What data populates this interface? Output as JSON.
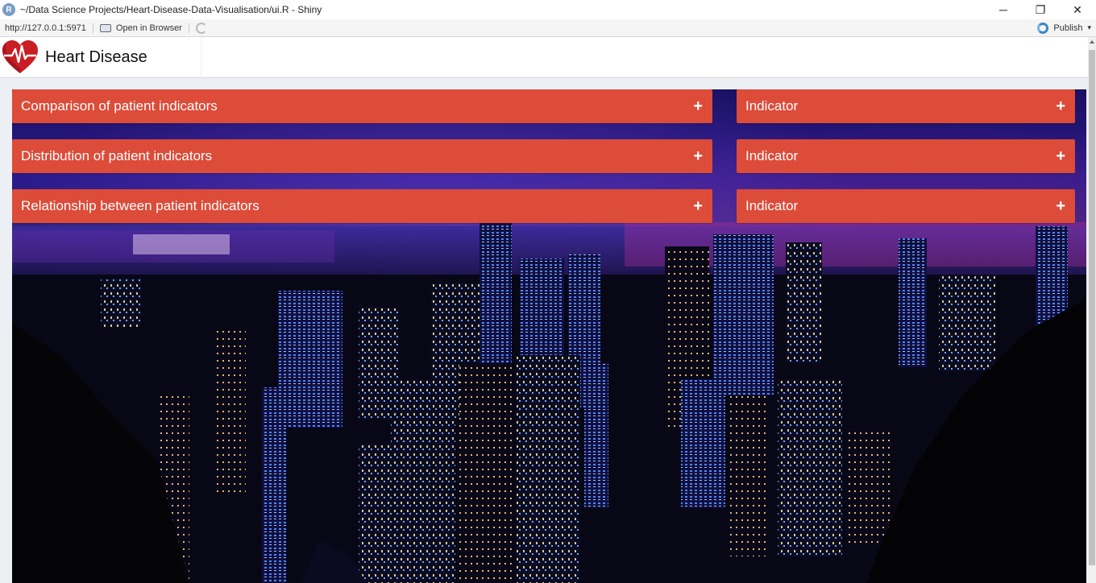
{
  "window": {
    "title": "~/Data Science Projects/Heart-Disease-Data-Visualisation/ui.R - Shiny",
    "app_icon": "R",
    "minimize": "─",
    "restore": "❐",
    "close": "✕"
  },
  "toolbar": {
    "url": "http://127.0.0.1:5971",
    "open_in_browser": "Open in Browser",
    "publish": "Publish",
    "publish_caret": "▾"
  },
  "header": {
    "title": "Heart Disease",
    "logo_icon": "heart-pulse-icon"
  },
  "colors": {
    "box_header": "#dd4b39",
    "header_bg": "#ffffff",
    "body_bg": "#ecf0f5"
  },
  "left_boxes": [
    {
      "title": "Comparison of patient indicators",
      "icon": "+"
    },
    {
      "title": "Distribution of patient indicators",
      "icon": "+"
    },
    {
      "title": "Relationship between patient indicators",
      "icon": "+"
    }
  ],
  "right_boxes": [
    {
      "title": "Indicator",
      "icon": "+"
    },
    {
      "title": "Indicator",
      "icon": "+"
    },
    {
      "title": "Indicator",
      "icon": "+"
    }
  ]
}
